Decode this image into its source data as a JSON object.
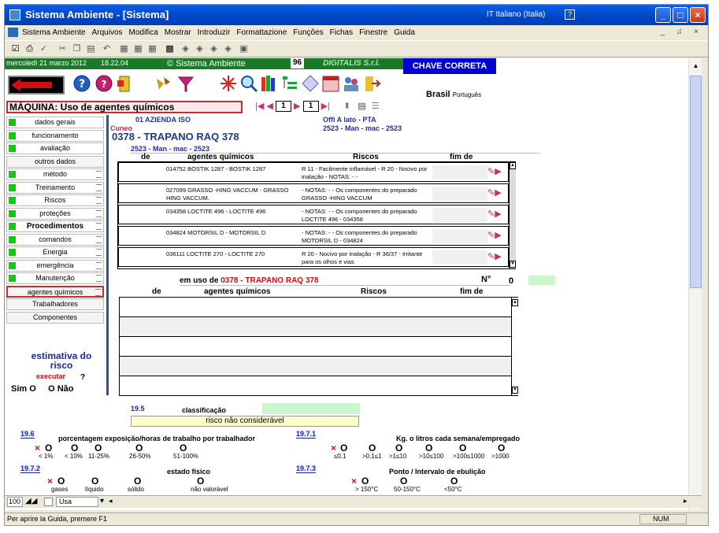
{
  "window": {
    "title": "Sistema Ambiente - [Sistema]",
    "language_indicator": "IT Italiano (Italia)",
    "help_indicator": "?"
  },
  "menu": {
    "items": [
      "Sistema Ambiente",
      "Arquivos",
      "Modifica",
      "Mostrar",
      "Introduzir",
      "Formattazione",
      "Funções",
      "Fichas",
      "Finestre",
      "Guida"
    ]
  },
  "header_strip": {
    "date": "mercoledì 21 marzo 2012",
    "time": "18.22.04",
    "copyright": "© Sistema Ambiente",
    "number": "96",
    "company": "DIGITALIS S.r.l.",
    "license": "CHAVE CORRETA",
    "language_main": "Brasil",
    "language_sub": "Português"
  },
  "section_title": "MÁQUINA: Uso de agentes químicos",
  "pager": {
    "record1": "1",
    "record2": "1"
  },
  "sidebar": {
    "items": [
      {
        "label": "dados gerais",
        "green": true,
        "grip": false
      },
      {
        "label": "funcionamento",
        "green": true,
        "grip": false
      },
      {
        "label": "avaliação",
        "green": true,
        "grip": false
      },
      {
        "label": "outros dados",
        "green": false,
        "grip": false
      },
      {
        "label": "método",
        "green": true,
        "grip": true
      },
      {
        "label": "Treinamento",
        "green": true,
        "grip": true
      },
      {
        "label": "Riscos",
        "green": true,
        "grip": true
      },
      {
        "label": "proteções",
        "green": true,
        "grip": true
      },
      {
        "label": "Procedimentos",
        "green": true,
        "grip": true
      },
      {
        "label": "comandos",
        "green": true,
        "grip": true
      },
      {
        "label": "Energia",
        "green": true,
        "grip": true
      },
      {
        "label": "emergência",
        "green": true,
        "grip": true
      },
      {
        "label": "Manutenção",
        "green": true,
        "grip": true
      },
      {
        "label": "agentes químicos",
        "green": false,
        "grip": true
      },
      {
        "label": "Trabalhadores",
        "green": false,
        "grip": false
      },
      {
        "label": "Componentes",
        "green": false,
        "grip": false
      }
    ]
  },
  "info": {
    "company": "01 AZIENDA ISO",
    "city": "Cuneo",
    "department": "Offi A lato - PTA",
    "model_code_right": "2523 - Man - mac - 2523",
    "machine": "0378 - TRAPANO RAQ  378",
    "model_code": "2523 - Man - mac - 2523"
  },
  "table1": {
    "headers": {
      "de": "de",
      "agentes": "agentes químicos",
      "riscos": "Riscos",
      "fim": "fim de"
    },
    "rows": [
      {
        "agente": "014752  BOSTIK 1287 - BOSTIK 1287",
        "riscos": "R 11 - Facilmente inflamável - R 20 - Nocivo por inalação - NOTAS: -  -"
      },
      {
        "agente": "027099  GRASSO -HING VACCUM  - GRASSO HING VACCUM.",
        "riscos": "- NOTAS: -  - Os componentes do preparado GRASSO -HING VACCUM"
      },
      {
        "agente": "034358  LOCTITE 496 - LOCTITE 496",
        "riscos": "- NOTAS: -  - Os componentes do preparado LOCTITE 496 - 034358"
      },
      {
        "agente": "034824  MOTORSIL D - MOTORSIL D",
        "riscos": "- NOTAS: -  - Os componentes do preparado MOTORSIL D - 034824"
      },
      {
        "agente": "036111  LOCTITE 270 - LOCTITE 270",
        "riscos": "R 20 - Nocivo por inalação - R 36/37 - Irritante para os olhos e vias"
      }
    ]
  },
  "em_uso": {
    "prefix": "em uso de",
    "machine": "0378 - TRAPANO RAQ  378",
    "n_label": "N°",
    "n_value": "0"
  },
  "table2": {
    "headers": {
      "de": "de",
      "agentes": "agentes químicos",
      "riscos": "Riscos",
      "fim": "fim de"
    }
  },
  "estimativa": {
    "title_line1": "estimativa do",
    "title_line2": "risco",
    "executar": "executar",
    "question": "?",
    "sim": "Sim",
    "nao": "Não"
  },
  "classificacao": {
    "code": "19.5",
    "label": "classificação",
    "result": "risco não considerável"
  },
  "q196": {
    "code": "19.6",
    "label": "porcentagem exposição/horas de trabalho por trabalhador",
    "options": [
      "< 1%",
      "< 10%",
      "11-25%",
      "26-50%",
      "51-100%"
    ]
  },
  "q1971": {
    "code": "19.7.1",
    "label": "Kg. o litros cada semana/empregado",
    "options": [
      "≤0,1",
      ">0,1≤1",
      ">1≤10",
      ">10≤100",
      ">100≤1000",
      ">1000"
    ]
  },
  "q1972": {
    "code": "19.7.2",
    "label": "estado físico",
    "options": [
      "gases",
      "líquido",
      "sólido",
      "não valorável"
    ]
  },
  "q1973": {
    "code": "19.7.3",
    "label": "Ponto / Intervalo de ebulição",
    "options": [
      "> 150°C",
      "50-150°C",
      "<50°C"
    ]
  },
  "sheetbar": {
    "zoom": "100",
    "view": "Usa"
  },
  "statusbar": {
    "message": "Per aprire la Guida, premere F1",
    "indicator": "NUM"
  }
}
